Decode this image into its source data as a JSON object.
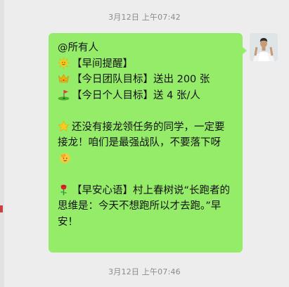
{
  "timestamps": {
    "top": "3月12日 上午07:42",
    "bottom": "3月12日 上午07:46"
  },
  "message": {
    "mention": "@所有人",
    "line_morning": "【早间提醒】",
    "line_team": "【今日团队目标】送出 200 张",
    "line_personal": "【今日个人目标】送 4 张/人",
    "para_reminder": "还没有接龙领任务的同学，一定要接龙！咱们是最强战队，不要落下呀",
    "para_quote": "【早安心语】村上春树说“长跑者的思维是：今天不想跑所以才去跑。”早安！"
  },
  "colors": {
    "bubble": "#95ec69",
    "background": "#ededed"
  },
  "icons": [
    "sun-emoji",
    "crown-emoji",
    "golf-flag-emoji",
    "glowing-star-emoji",
    "saluting-face-emoji",
    "rose-emoji"
  ]
}
